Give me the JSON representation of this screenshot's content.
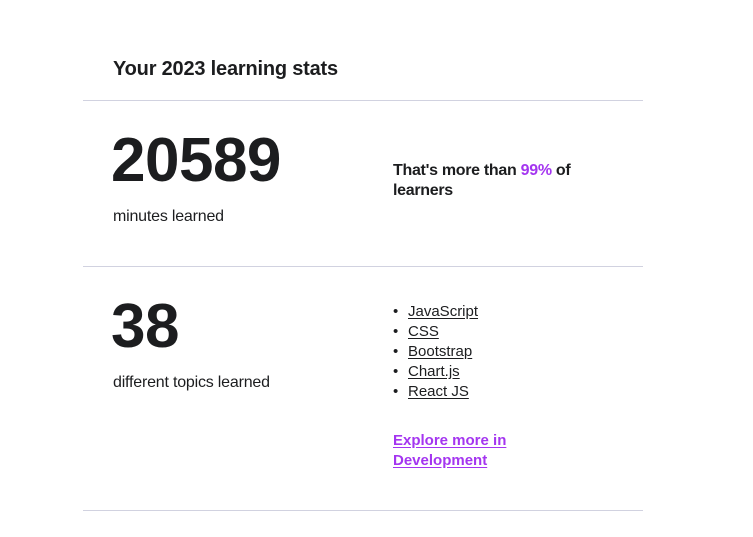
{
  "stats": {
    "heading": "Your 2023 learning stats",
    "minutes": {
      "value": "20589",
      "label": "minutes learned",
      "comparison_prefix": "That's more than ",
      "comparison_percent": "99%",
      "comparison_suffix": " of learners"
    },
    "topics": {
      "value": "38",
      "label": "different topics learned",
      "items": [
        {
          "label": "JavaScript"
        },
        {
          "label": "CSS"
        },
        {
          "label": "Bootstrap"
        },
        {
          "label": "Chart.js"
        },
        {
          "label": "React JS"
        }
      ],
      "bullet": "•",
      "explore_link": "Explore more in Development"
    }
  },
  "colors": {
    "accent": "#a435f0",
    "text": "#1c1d1f",
    "divider": "#d1d2e0"
  }
}
